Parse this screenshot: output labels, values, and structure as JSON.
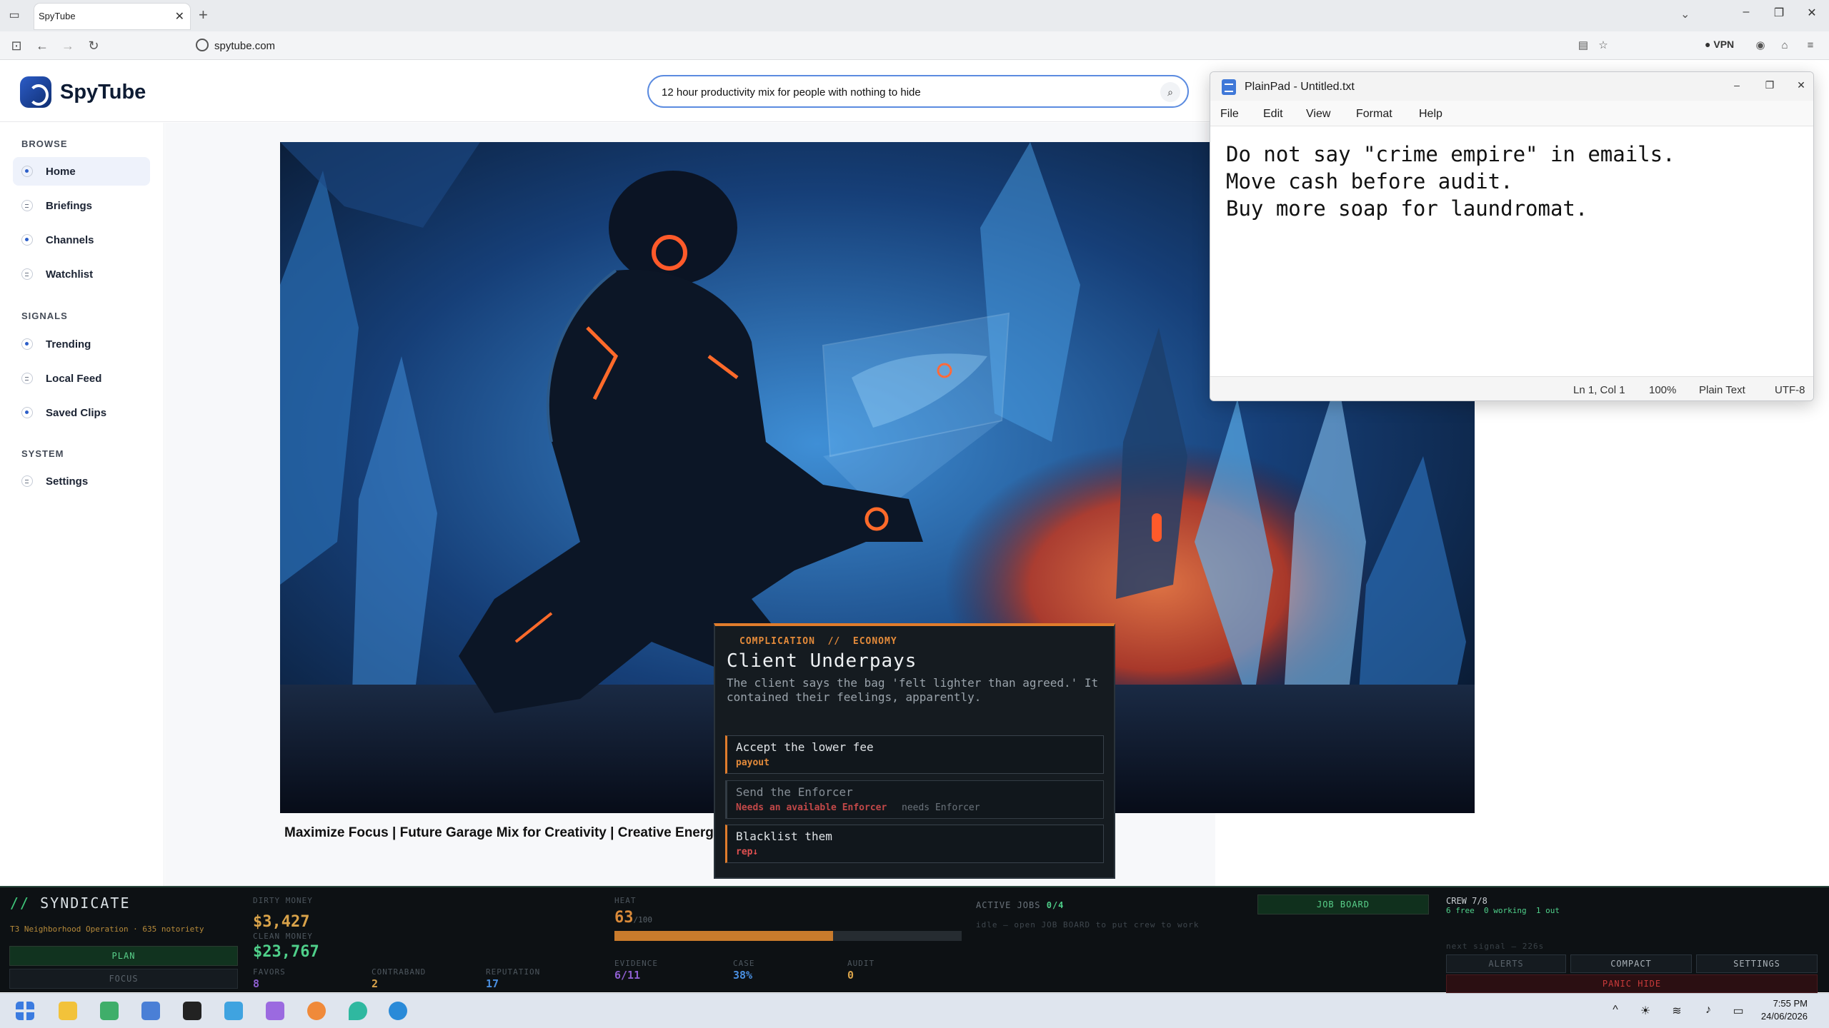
{
  "browser": {
    "tab_title": "SpyTube",
    "url": "spytube.com",
    "vpn_label": "VPN"
  },
  "site": {
    "brand": "SpyTube",
    "search": {
      "value": "12 hour productivity mix for people with nothing to hide"
    },
    "sidebar": {
      "sections": [
        {
          "title": "BROWSE",
          "items": [
            {
              "label": "Home",
              "icon": "dot-icon",
              "active": true
            },
            {
              "label": "Briefings",
              "icon": "list-icon"
            },
            {
              "label": "Channels",
              "icon": "dot-icon"
            },
            {
              "label": "Watchlist",
              "icon": "list-icon"
            }
          ]
        },
        {
          "title": "SIGNALS",
          "items": [
            {
              "label": "Trending",
              "icon": "dot-icon"
            },
            {
              "label": "Local Feed",
              "icon": "list-icon"
            },
            {
              "label": "Saved Clips",
              "icon": "dot-icon"
            }
          ]
        },
        {
          "title": "SYSTEM",
          "items": [
            {
              "label": "Settings",
              "icon": "list-icon"
            }
          ]
        }
      ]
    },
    "video": {
      "title": "Maximize Focus | Future Garage Mix for Creativity | Creative Energy"
    }
  },
  "plainpad": {
    "title": "PlainPad - Untitled.txt",
    "menus": [
      "File",
      "Edit",
      "View",
      "Format",
      "Help"
    ],
    "content": "Do not say \"crime empire\" in emails.\nMove cash before audit.\nBuy more soap for laundromat.",
    "status": {
      "position": "Ln 1, Col 1",
      "zoom": "100%",
      "mode": "Plain Text",
      "encoding": "UTF-8"
    }
  },
  "complication": {
    "tag": "COMPLICATION  //  ECONOMY",
    "title": "Client Underpays",
    "description": "The client says the bag 'felt lighter than agreed.' It contained their feelings, apparently.",
    "choices": [
      {
        "label": "Accept the lower fee",
        "sub": "payout",
        "sub_color": "#e38a3a"
      },
      {
        "label": "Send the Enforcer",
        "sub": "Needs an available Enforcer",
        "sub_color": "#e05050",
        "extra": "needs Enforcer"
      },
      {
        "label": "Blacklist them",
        "sub": "rep↓",
        "sub_color": "#e05050"
      }
    ]
  },
  "hud": {
    "title_prefix": "//",
    "title": "SYNDICATE",
    "operation": "T3 Neighborhood Operation · 635 notoriety",
    "plan_label": "PLAN",
    "focus_label": "FOCUS",
    "dirty_money_label": "DIRTY MONEY",
    "dirty_money": "$3,427",
    "clean_money_label": "CLEAN MONEY",
    "clean_money": "$23,767",
    "favors_label": "FAVORS",
    "favors": "8",
    "contraband_label": "CONTRABAND",
    "contraband": "2",
    "reputation_label": "REPUTATION",
    "reputation": "17",
    "heat_label": "HEAT",
    "heat": "63",
    "heat_max": "/100",
    "heat_fraction": 0.63,
    "evidence_label": "EVIDENCE",
    "evidence": "6/11",
    "case_label": "CASE",
    "case": "38%",
    "audit_label": "AUDIT",
    "audit": "0",
    "active_jobs_label": "ACTIVE JOBS",
    "active_jobs": "0/4",
    "idle_text": "idle — open JOB BOARD to put crew to work",
    "job_board_label": "JOB BOARD",
    "crew_label": "CREW 7/8",
    "crew_status": "6 free  0 working  1 out",
    "next_signal": "next signal — 226s",
    "alerts_label": "ALERTS",
    "compact_label": "COMPACT",
    "settings_label": "SETTINGS",
    "panic_label": "PANIC HIDE"
  },
  "taskbar": {
    "time": "7:55 PM",
    "date": "24/06/2026"
  },
  "colors": {
    "accent_blue": "#5b8be0",
    "hud_green": "#59d08a",
    "hud_orange": "#e07c2c",
    "heat_purple": "#8e5fd0",
    "case_blue": "#4a8fe0"
  }
}
